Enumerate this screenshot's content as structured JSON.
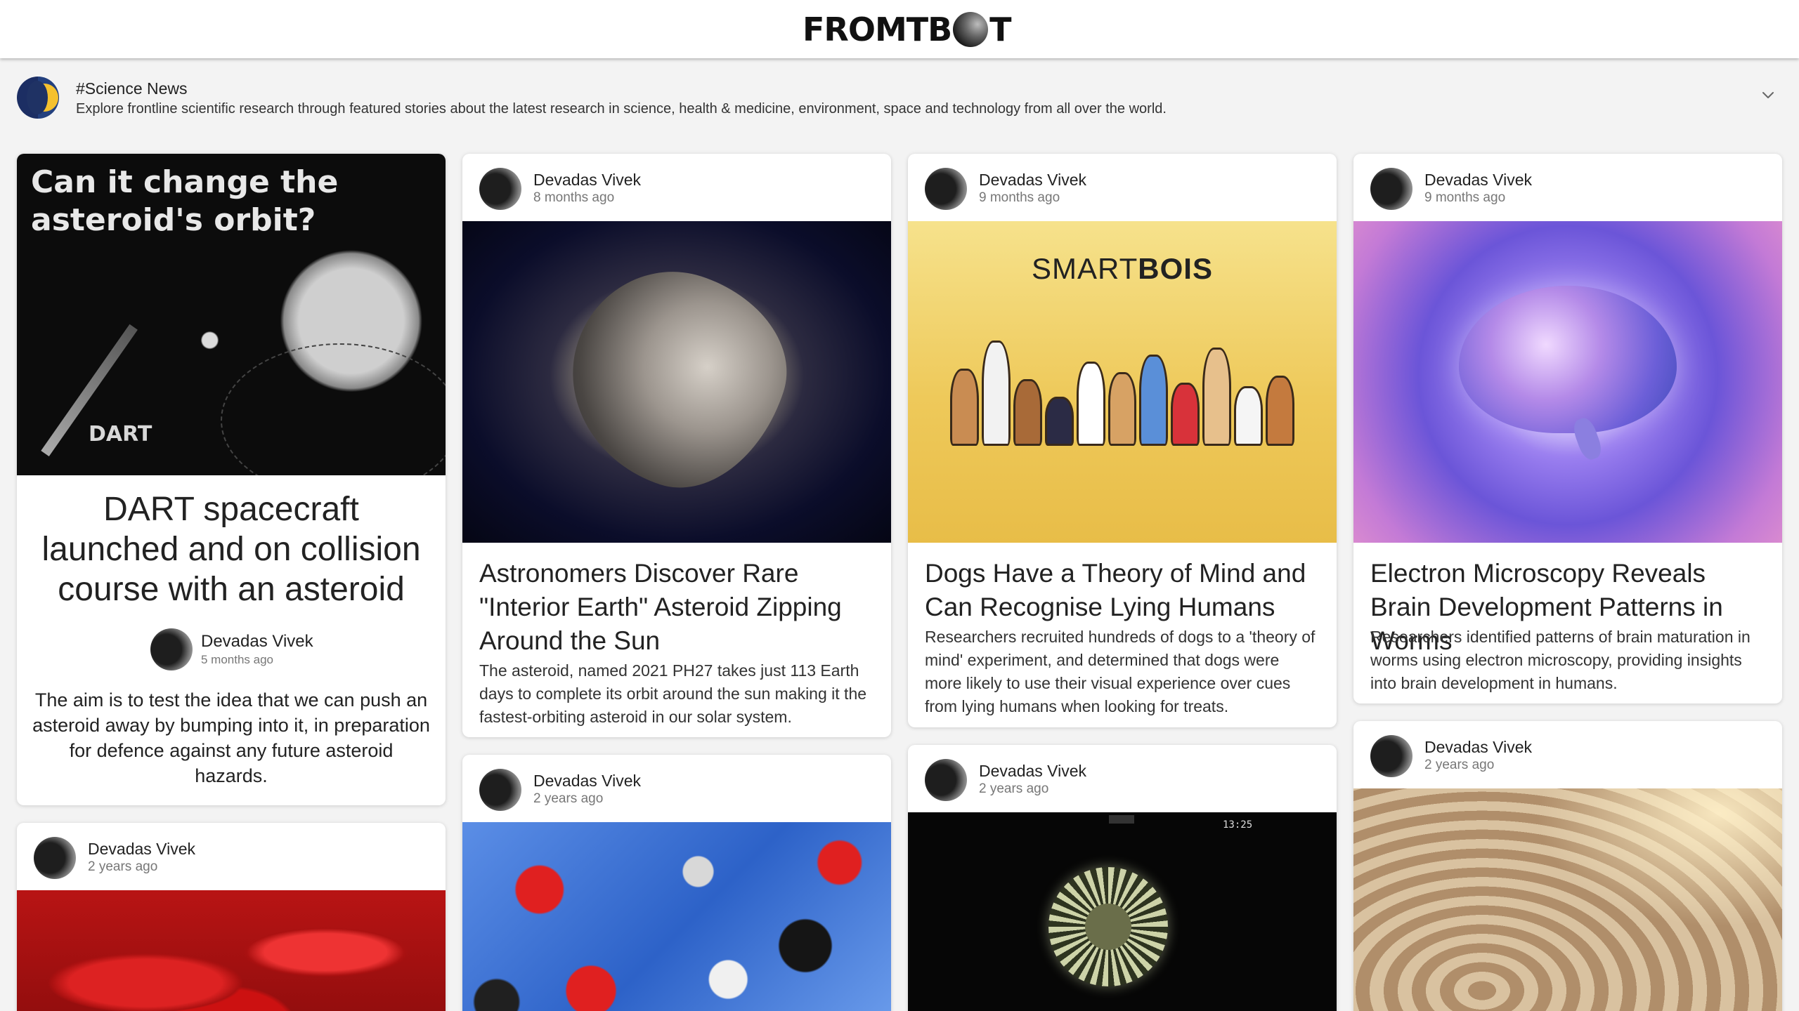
{
  "header": {
    "logo_left": "FROMTB",
    "logo_right": "T",
    "logo_alt": "FROMTBOT"
  },
  "topic": {
    "title": "#Science News",
    "description": "Explore frontline scientific research through featured stories about the latest research in science, health & medicine, environment, space and technology from all over the world."
  },
  "featured": {
    "image_title": "Can it change the asteroid's orbit?",
    "image_label": "DART",
    "headline": "DART spacecraft launched and on collision course with an asteroid",
    "author": "Devadas Vivek",
    "time": "5 months ago",
    "excerpt": "The aim is to test the idea that we can push an asteroid away by bumping into it, in preparation for defence against any future asteroid hazards."
  },
  "cards": [
    {
      "author": "Devadas Vivek",
      "time": "8 months ago",
      "headline": "Astronomers Discover Rare \"Interior Earth\" Asteroid Zipping Around the Sun",
      "excerpt": "The asteroid, named 2021 PH27 takes just 113 Earth days to complete its orbit around the sun making it the fastest-orbiting asteroid in our solar system."
    },
    {
      "author": "Devadas Vivek",
      "time": "9 months ago",
      "image_brand_light": "SMART",
      "image_brand_bold": "BOIS",
      "headline": "Dogs Have a Theory of Mind and Can Recognise Lying Humans",
      "excerpt": "Researchers recruited hundreds of dogs to a 'theory of mind' experiment, and determined that dogs were more likely to use their visual experience over cues from lying humans when looking for treats."
    },
    {
      "author": "Devadas Vivek",
      "time": "9 months ago",
      "headline": "Electron Microscopy Reveals Brain Development Patterns in Worms",
      "excerpt": "Researchers identified patterns of brain maturation in worms using electron microscopy, providing insights into brain development in humans."
    },
    {
      "author": "Devadas Vivek",
      "time": "2 years ago"
    },
    {
      "author": "Devadas Vivek",
      "time": "2 years ago"
    },
    {
      "author": "Devadas Vivek",
      "time": "2 years ago",
      "image_clock": "13:25"
    },
    {
      "author": "Devadas Vivek",
      "time": "2 years ago"
    }
  ]
}
